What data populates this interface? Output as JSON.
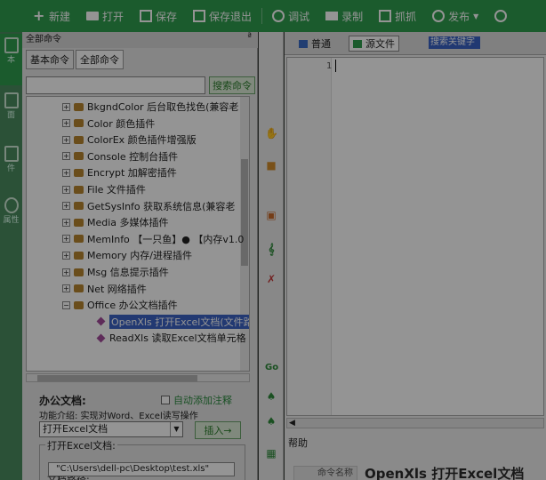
{
  "toolbar": {
    "items": [
      {
        "label": "新建",
        "icon": "plus-icon"
      },
      {
        "label": "打开",
        "icon": "folder-icon"
      },
      {
        "label": "保存",
        "icon": "save-icon"
      },
      {
        "label": "保存退出",
        "icon": "save-exit-icon"
      },
      {
        "label": "调试",
        "icon": "play-icon"
      },
      {
        "label": "录制",
        "icon": "camera-icon"
      },
      {
        "label": "抓抓",
        "icon": "capture-icon"
      },
      {
        "label": "发布",
        "icon": "publish-icon"
      },
      {
        "label": "",
        "icon": "settings-icon"
      }
    ]
  },
  "sidebar": {
    "items": [
      {
        "label": "本",
        "icon": "script-icon"
      },
      {
        "label": "面",
        "icon": "interface-icon"
      },
      {
        "label": "件",
        "icon": "file-icon"
      },
      {
        "label": "属性",
        "icon": "info-icon"
      }
    ]
  },
  "panel": {
    "title": "全部命令",
    "pin": "ª",
    "tabs": [
      "基本命令",
      "全部命令"
    ],
    "search": {
      "value": "",
      "button": "搜索命令"
    },
    "tree": [
      {
        "label": "BkgndColor 后台取色找色(兼容老",
        "type": "plugin",
        "expander": "+"
      },
      {
        "label": "Color 颜色插件",
        "type": "plugin",
        "expander": "+"
      },
      {
        "label": "ColorEx 颜色插件增强版",
        "type": "plugin",
        "expander": "+"
      },
      {
        "label": "Console 控制台插件",
        "type": "plugin",
        "expander": "+"
      },
      {
        "label": "Encrypt 加解密插件",
        "type": "plugin",
        "expander": "+"
      },
      {
        "label": "File 文件插件",
        "type": "plugin",
        "expander": "+"
      },
      {
        "label": "GetSysInfo 获取系统信息(兼容老",
        "type": "plugin",
        "expander": "+"
      },
      {
        "label": "Media 多媒体插件",
        "type": "plugin",
        "expander": "+"
      },
      {
        "label": "MemInfo 【一只鱼】● 【内存v1.0",
        "type": "plugin",
        "expander": "+"
      },
      {
        "label": "Memory 内存/进程插件",
        "type": "plugin",
        "expander": "+"
      },
      {
        "label": "Msg 信息提示插件",
        "type": "plugin",
        "expander": "+"
      },
      {
        "label": "Net 网络插件",
        "type": "plugin",
        "expander": "+"
      },
      {
        "label": "Office 办公文档插件",
        "type": "plugin",
        "expander": "−"
      },
      {
        "label": "OpenXls 打开Excel文档(文件路",
        "type": "command",
        "selected": true
      },
      {
        "label": "ReadXls 读取Excel文档单元格",
        "type": "command"
      }
    ],
    "info": {
      "title": "办公文档:",
      "auto_note": "自动添加注释",
      "func_desc": "功能介绍: 实现对Word、Excel读写操作",
      "select_value": "打开Excel文档",
      "insert_button": "插入→",
      "group_label": "打开Excel文档:",
      "path_label": "文档路径:",
      "path_value": "\"C:\\Users\\dell-pc\\Desktop\\test.xls\""
    }
  },
  "editor": {
    "tabs": [
      {
        "label": "普通",
        "icon": "normal-view-icon"
      },
      {
        "label": "源文件",
        "icon": "source-view-icon"
      }
    ],
    "search_text": "搜索关键字",
    "line_number": "1",
    "help": {
      "title": "帮助",
      "command_key": "命令名称",
      "command_value": "OpenXls 打开Excel文档"
    }
  }
}
